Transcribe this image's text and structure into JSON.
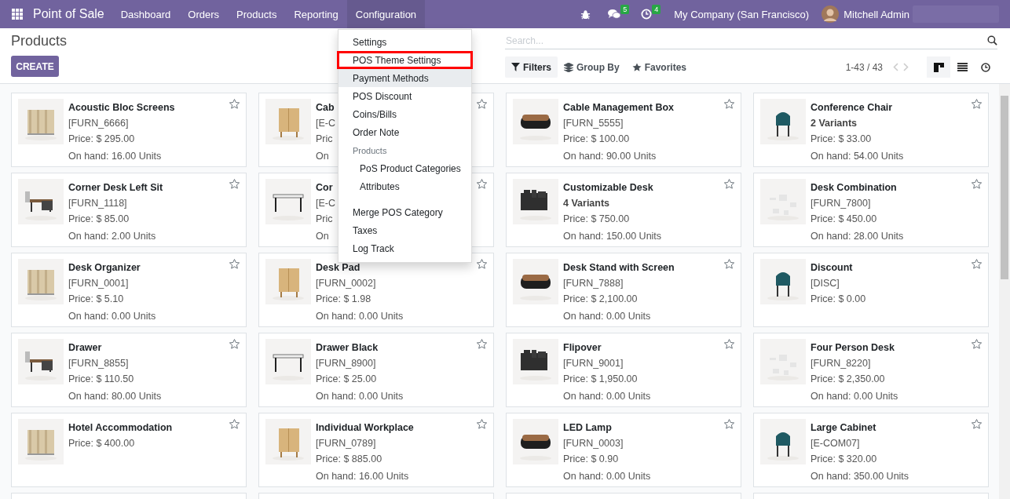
{
  "navbar": {
    "app_title": "Point of Sale",
    "menus": [
      {
        "label": "Dashboard",
        "selected": false
      },
      {
        "label": "Orders",
        "selected": false
      },
      {
        "label": "Products",
        "selected": false
      },
      {
        "label": "Reporting",
        "selected": false
      },
      {
        "label": "Configuration",
        "selected": true
      }
    ],
    "messages_count": "5",
    "activities_count": "4",
    "company": "My Company (San Francisco)",
    "user": "Mitchell Admin"
  },
  "control_panel": {
    "title": "Products",
    "create_button": "CREATE",
    "search": {
      "placeholder": "Search..."
    },
    "filters": [
      {
        "kind": "filter",
        "label": "Filters",
        "selected": true
      },
      {
        "kind": "group",
        "label": "Group By",
        "selected": false
      },
      {
        "kind": "favorite",
        "label": "Favorites",
        "selected": false
      }
    ],
    "pager": "1-43 / 43",
    "views": [
      {
        "kind": "kanban",
        "selected": true
      },
      {
        "kind": "list",
        "selected": false
      },
      {
        "kind": "activity",
        "selected": false
      }
    ]
  },
  "dropdown": {
    "items": [
      {
        "kind": "item",
        "label": "Settings",
        "highlighted": false,
        "hovered": false
      },
      {
        "kind": "item",
        "label": "POS Theme Settings",
        "highlighted": true,
        "hovered": false
      },
      {
        "kind": "item",
        "label": "Payment Methods",
        "highlighted": false,
        "hovered": true
      },
      {
        "kind": "item",
        "label": "POS Discount",
        "highlighted": false,
        "hovered": false
      },
      {
        "kind": "item",
        "label": "Coins/Bills",
        "highlighted": false,
        "hovered": false
      },
      {
        "kind": "item",
        "label": "Order Note",
        "highlighted": false,
        "hovered": false
      },
      {
        "kind": "header",
        "label": "Products"
      },
      {
        "kind": "subitem",
        "label": "PoS Product Categories",
        "highlighted": false,
        "hovered": false
      },
      {
        "kind": "subitem",
        "label": "Attributes",
        "highlighted": false,
        "hovered": false
      },
      {
        "kind": "gap"
      },
      {
        "kind": "item",
        "label": "Merge POS Category",
        "highlighted": false,
        "hovered": false
      },
      {
        "kind": "item",
        "label": "Taxes",
        "highlighted": false,
        "hovered": false
      },
      {
        "kind": "item",
        "label": "Log Track",
        "highlighted": false,
        "hovered": false
      }
    ]
  },
  "products": [
    {
      "kind": "product",
      "name": "Acoustic Bloc Screens",
      "lines": [
        {
          "kind": "code",
          "text": "[FURN_6666]"
        },
        {
          "kind": "price",
          "text": "Price: $ 295.00"
        },
        {
          "kind": "stock",
          "text": "On hand: 16.00 Units"
        }
      ]
    },
    {
      "kind": "product",
      "name": "Cab",
      "lines": [
        {
          "kind": "code",
          "text": "[E-C"
        },
        {
          "kind": "price",
          "text": "Pric"
        },
        {
          "kind": "stock",
          "text": "On"
        }
      ]
    },
    {
      "kind": "product",
      "name": "Cable Management Box",
      "lines": [
        {
          "kind": "code",
          "text": "[FURN_5555]"
        },
        {
          "kind": "price",
          "text": "Price: $ 100.00"
        },
        {
          "kind": "stock",
          "text": "On hand: 90.00 Units"
        }
      ]
    },
    {
      "kind": "product",
      "name": "Conference Chair",
      "lines": [
        {
          "kind": "variants",
          "text": "2 Variants"
        },
        {
          "kind": "price",
          "text": "Price: $ 33.00"
        },
        {
          "kind": "stock",
          "text": "On hand: 54.00 Units"
        }
      ]
    },
    {
      "kind": "product",
      "name": "Corner Desk Left Sit",
      "lines": [
        {
          "kind": "code",
          "text": "[FURN_1118]"
        },
        {
          "kind": "price",
          "text": "Price: $ 85.00"
        },
        {
          "kind": "stock",
          "text": "On hand: 2.00 Units"
        }
      ]
    },
    {
      "kind": "product",
      "name": "Cor",
      "lines": [
        {
          "kind": "code",
          "text": "[E-C"
        },
        {
          "kind": "price",
          "text": "Pric"
        },
        {
          "kind": "stock",
          "text": "On"
        }
      ]
    },
    {
      "kind": "product",
      "name": "Customizable Desk",
      "lines": [
        {
          "kind": "variants",
          "text": "4 Variants"
        },
        {
          "kind": "price",
          "text": "Price: $ 750.00"
        },
        {
          "kind": "stock",
          "text": "On hand: 150.00 Units"
        }
      ]
    },
    {
      "kind": "product",
      "name": "Desk Combination",
      "lines": [
        {
          "kind": "code",
          "text": "[FURN_7800]"
        },
        {
          "kind": "price",
          "text": "Price: $ 450.00"
        },
        {
          "kind": "stock",
          "text": "On hand: 28.00 Units"
        }
      ]
    },
    {
      "kind": "product",
      "name": "Desk Organizer",
      "lines": [
        {
          "kind": "code",
          "text": "[FURN_0001]"
        },
        {
          "kind": "price",
          "text": "Price: $ 5.10"
        },
        {
          "kind": "stock",
          "text": "On hand: 0.00 Units"
        }
      ]
    },
    {
      "kind": "product",
      "name": "Desk Pad",
      "lines": [
        {
          "kind": "code",
          "text": "[FURN_0002]"
        },
        {
          "kind": "price",
          "text": "Price: $ 1.98"
        },
        {
          "kind": "stock",
          "text": "On hand: 0.00 Units"
        }
      ]
    },
    {
      "kind": "product",
      "name": "Desk Stand with Screen",
      "lines": [
        {
          "kind": "code",
          "text": "[FURN_7888]"
        },
        {
          "kind": "price",
          "text": "Price: $ 2,100.00"
        },
        {
          "kind": "stock",
          "text": "On hand: 0.00 Units"
        }
      ]
    },
    {
      "kind": "product",
      "name": "Discount",
      "lines": [
        {
          "kind": "code",
          "text": "[DISC]"
        },
        {
          "kind": "price",
          "text": "Price: $ 0.00"
        }
      ]
    },
    {
      "kind": "product",
      "name": "Drawer",
      "lines": [
        {
          "kind": "code",
          "text": "[FURN_8855]"
        },
        {
          "kind": "price",
          "text": "Price: $ 110.50"
        },
        {
          "kind": "stock",
          "text": "On hand: 80.00 Units"
        }
      ]
    },
    {
      "kind": "product",
      "name": "Drawer Black",
      "lines": [
        {
          "kind": "code",
          "text": "[FURN_8900]"
        },
        {
          "kind": "price",
          "text": "Price: $ 25.00"
        },
        {
          "kind": "stock",
          "text": "On hand: 0.00 Units"
        }
      ]
    },
    {
      "kind": "product",
      "name": "Flipover",
      "lines": [
        {
          "kind": "code",
          "text": "[FURN_9001]"
        },
        {
          "kind": "price",
          "text": "Price: $ 1,950.00"
        },
        {
          "kind": "stock",
          "text": "On hand: 0.00 Units"
        }
      ]
    },
    {
      "kind": "product",
      "name": "Four Person Desk",
      "lines": [
        {
          "kind": "code",
          "text": "[FURN_8220]"
        },
        {
          "kind": "price",
          "text": "Price: $ 2,350.00"
        },
        {
          "kind": "stock",
          "text": "On hand: 0.00 Units"
        }
      ]
    },
    {
      "kind": "product",
      "name": "Hotel Accommodation",
      "lines": [
        {
          "kind": "price",
          "text": "Price: $ 400.00"
        }
      ]
    },
    {
      "kind": "product",
      "name": "Individual Workplace",
      "lines": [
        {
          "kind": "code",
          "text": "[FURN_0789]"
        },
        {
          "kind": "price",
          "text": "Price: $ 885.00"
        },
        {
          "kind": "stock",
          "text": "On hand: 16.00 Units"
        }
      ]
    },
    {
      "kind": "product",
      "name": "LED Lamp",
      "lines": [
        {
          "kind": "code",
          "text": "[FURN_0003]"
        },
        {
          "kind": "price",
          "text": "Price: $ 0.90"
        },
        {
          "kind": "stock",
          "text": "On hand: 0.00 Units"
        }
      ]
    },
    {
      "kind": "product",
      "name": "Large Cabinet",
      "lines": [
        {
          "kind": "code",
          "text": "[E-COM07]"
        },
        {
          "kind": "price",
          "text": "Price: $ 320.00"
        },
        {
          "kind": "stock",
          "text": "On hand: 350.00 Units"
        }
      ]
    },
    {
      "kind": "clipped"
    },
    {
      "kind": "clipped"
    },
    {
      "kind": "clipped"
    },
    {
      "kind": "clipped"
    }
  ]
}
